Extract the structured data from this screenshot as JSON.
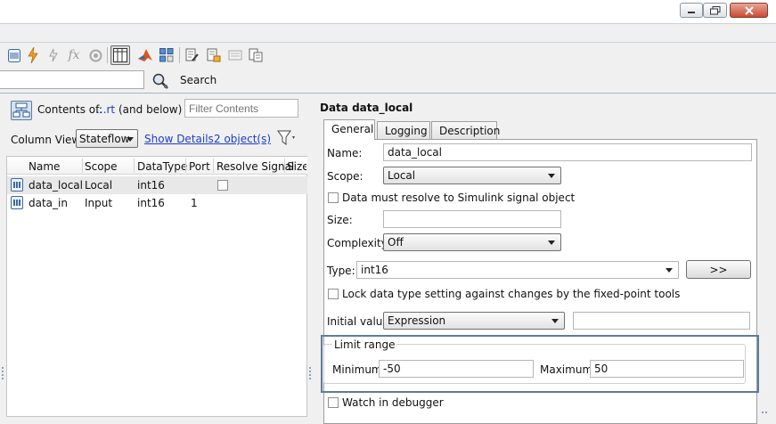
{
  "toolbar": {
    "icons": [
      "data-icon",
      "event-icon",
      "function-icon",
      "fx-icon",
      "target-icon",
      "table-view-icon",
      "matlab-icon",
      "grid-icon",
      "edit-icon",
      "add-icon",
      "copy-icon",
      "paste-icon"
    ],
    "fx_glyph": "fx"
  },
  "search": {
    "value": "",
    "label": "Search"
  },
  "contents": {
    "label": "Contents of:",
    "link": "...rt",
    "scope": "(and below)",
    "filter_placeholder": "Filter Contents"
  },
  "column_view": {
    "label": "Column View:",
    "selected": "Stateflow",
    "show_details": "Show Details",
    "objects_count": "2 object(s)"
  },
  "table": {
    "columns": [
      "Name",
      "Scope",
      "DataType",
      "Port",
      "Resolve Signal",
      "Size"
    ],
    "rows": [
      {
        "name": "data_local",
        "scope": "Local",
        "datatype": "int16",
        "port": "",
        "resolve_signal": false
      },
      {
        "name": "data_in",
        "scope": "Input",
        "datatype": "int16",
        "port": "1",
        "resolve_signal": null
      }
    ]
  },
  "dialog": {
    "title": "Data data_local",
    "tabs": [
      "General",
      "Logging",
      "Description"
    ],
    "active_tab": "General",
    "name_label": "Name:",
    "name_value": "data_local",
    "scope_label": "Scope:",
    "scope_value": "Local",
    "resolve_label": "Data must resolve to Simulink signal object",
    "size_label": "Size:",
    "size_value": "",
    "complexity_label": "Complexity:",
    "complexity_value": "Off",
    "type_label": "Type:",
    "type_value": "int16",
    "type_button": ">>",
    "lock_label": "Lock data type setting against changes by the fixed-point tools",
    "initial_label": "Initial value:",
    "initial_value": "Expression",
    "initial_text": "",
    "limit_range_label": "Limit range",
    "minimum_label": "Minimum:",
    "minimum_value": "-50",
    "maximum_label": "Maximum:",
    "maximum_value": "50",
    "watch_label": "Watch in debugger"
  }
}
